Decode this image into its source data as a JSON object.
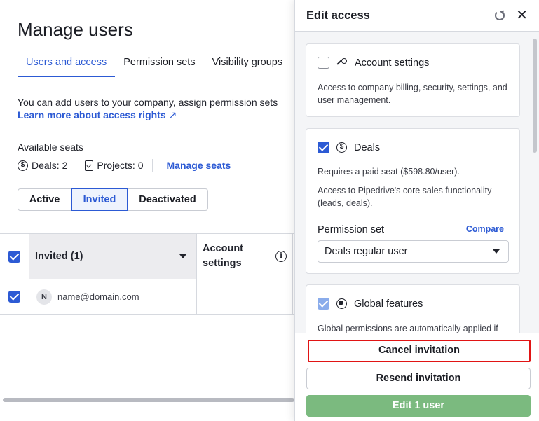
{
  "page": {
    "title": "Manage users",
    "tabs": [
      {
        "label": "Users and access",
        "active": true
      },
      {
        "label": "Permission sets",
        "active": false
      },
      {
        "label": "Visibility groups",
        "active": false
      }
    ],
    "intro": "You can add users to your company, assign permission sets",
    "learn_link": "Learn more about access rights",
    "learn_arrow": "↗",
    "seats_title": "Available seats",
    "seats": {
      "deals": "Deals: 2",
      "projects": "Projects: 0",
      "manage": "Manage seats"
    },
    "filter": {
      "options": [
        "Active",
        "Invited",
        "Deactivated"
      ],
      "selected": "Invited"
    },
    "table": {
      "headers": {
        "name": "Invited (1)",
        "account": "Account settings"
      },
      "rows": [
        {
          "avatar": "N",
          "email": "name@domain.com",
          "account": "—",
          "checked": true
        }
      ]
    }
  },
  "drawer": {
    "title": "Edit access",
    "cards": {
      "account_settings": {
        "title": "Account settings",
        "checked": false,
        "desc": "Access to company billing, security, settings, and user management."
      },
      "deals": {
        "title": "Deals",
        "checked": true,
        "price": "Requires a paid seat ($598.80/user).",
        "desc": "Access to Pipedrive's core sales functionality (leads, deals).",
        "permission_label": "Permission set",
        "compare": "Compare",
        "selected_set": "Deals regular user"
      },
      "global": {
        "title": "Global features",
        "checked": true,
        "desc": "Global permissions are automatically applied if"
      }
    },
    "buttons": {
      "cancel": "Cancel invitation",
      "resend": "Resend invitation",
      "edit": "Edit 1 user"
    }
  },
  "colors": {
    "accent": "#2c5ad4",
    "primary_button": "#7bba7f",
    "highlight_border": "#e11414"
  }
}
